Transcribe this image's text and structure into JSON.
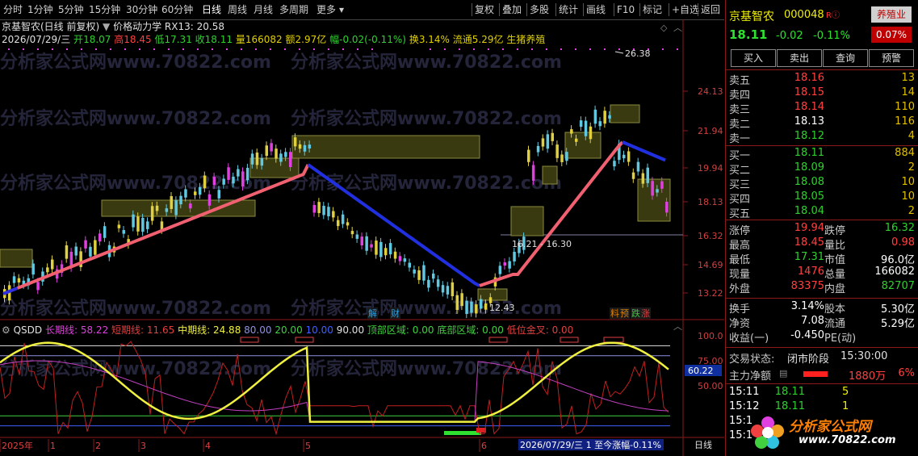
{
  "toolbar": {
    "periods": [
      "分时",
      "1分钟",
      "5分钟",
      "15分钟",
      "30分钟",
      "60分钟",
      "日线",
      "周线",
      "月线",
      "多周期",
      "更多"
    ],
    "active_period": "日线",
    "tools": [
      "复权",
      "叠加",
      "多股",
      "统计",
      "画线",
      "F10",
      "标记",
      "+自选",
      "返回"
    ]
  },
  "chart": {
    "title": "京基智农(日线 前复权)",
    "indicator_name": "价格动力学",
    "indicator_value": "RX13: 20.58",
    "info_date": "2026/07/29/三",
    "info_open_label": "开",
    "info_open": "18.07",
    "info_high_label": "高",
    "info_high": "18.45",
    "info_low_label": "低",
    "info_low": "17.31",
    "info_close_label": "收",
    "info_close": "18.11",
    "info_vol_label": "量",
    "info_vol": "166082",
    "info_amt_label": "额",
    "info_amt": "2.97亿",
    "info_chg_label": "幅",
    "info_chg": "-0.02(-0.11%)",
    "info_turn_label": "换",
    "info_turn": "3.14%",
    "info_float_label": "流通",
    "info_float": "5.29亿",
    "info_sector": "生猪养殖",
    "price_axis": [
      "24.13",
      "21.94",
      "19.94",
      "18.13",
      "16.32",
      "14.69",
      "13.22"
    ],
    "marks": {
      "high": "26.38",
      "low": "12.43",
      "box": "16.21 - 16.30"
    },
    "events": [
      "解",
      "财",
      "料",
      "预",
      "跌",
      "涨"
    ],
    "watermark": "分析家公式网www.70822.com"
  },
  "indicator": {
    "name": "QSDD",
    "long_label": "长期线:",
    "long_value": "58.22",
    "short_label": "短期线:",
    "short_value": "11.65",
    "mid_label": "中期线:",
    "mid_value": "24.88",
    "lvl80": "80.00",
    "lvl20": "20.00",
    "lvl10": "10.00",
    "lvl90": "90.00",
    "top_zone": "顶部区域: 0.00",
    "bottom_zone": "底部区域: 0.00",
    "golden": "低位金叉: 0.00",
    "axis": [
      "100.0",
      "75.00",
      "50.00"
    ],
    "current_tag": "60.22"
  },
  "timeline": {
    "labels": [
      "2025年",
      "1",
      "2",
      "3",
      "4",
      "5",
      "6"
    ],
    "status": "2026/07/29/三  1 至今涨幅-0.11%",
    "period": "日线"
  },
  "panel": {
    "name": "京基智农",
    "code": "000048",
    "badge": "R",
    "sector": "养殖业",
    "price": "18.11",
    "change": "-0.02",
    "pct": "-0.11%",
    "weight": "0.07%",
    "buttons": [
      "买入",
      "卖出",
      "查询",
      "预警"
    ],
    "asks": [
      {
        "label": "卖五",
        "price": "18.16",
        "vol": "13"
      },
      {
        "label": "卖四",
        "price": "18.15",
        "vol": "14"
      },
      {
        "label": "卖三",
        "price": "18.14",
        "vol": "110"
      },
      {
        "label": "卖二",
        "price": "18.13",
        "vol": "116"
      },
      {
        "label": "卖一",
        "price": "18.12",
        "vol": "4"
      }
    ],
    "bids": [
      {
        "label": "买一",
        "price": "18.11",
        "vol": "884"
      },
      {
        "label": "买二",
        "price": "18.09",
        "vol": "2"
      },
      {
        "label": "买三",
        "price": "18.08",
        "vol": "10"
      },
      {
        "label": "买四",
        "price": "18.05",
        "vol": "10"
      },
      {
        "label": "买五",
        "price": "18.04",
        "vol": "2"
      }
    ],
    "stats": [
      {
        "l1": "涨停",
        "v1": "19.94",
        "l2": "跌停",
        "v2": "16.32"
      },
      {
        "l1": "最高",
        "v1": "18.45",
        "l2": "量比",
        "v2": "0.98"
      },
      {
        "l1": "最低",
        "v1": "17.31",
        "l2": "市值",
        "v2": "96.0亿"
      },
      {
        "l1": "现量",
        "v1": "1476",
        "l2": "总量",
        "v2": "166082"
      },
      {
        "l1": "外盘",
        "v1": "83375",
        "l2": "内盘",
        "v2": "82707"
      }
    ],
    "stats2": [
      {
        "l1": "换手",
        "v1": "3.14%",
        "l2": "股本",
        "v2": "5.30亿"
      },
      {
        "l1": "净资",
        "v1": "7.08",
        "l2": "流通",
        "v2": "5.29亿"
      },
      {
        "l1": "收益(一)",
        "v1": "-0.450",
        "l2": "PE(动)",
        "v2": ""
      }
    ],
    "trade_status_label": "交易状态:",
    "trade_status": "闭市阶段",
    "trade_time": "15:30:00",
    "main_flow_label": "主力净额",
    "main_flow": "1880万",
    "main_flow_pct": "6%",
    "ticks": [
      {
        "t": "15:11",
        "p": "18.11",
        "v": "5"
      },
      {
        "t": "15:12",
        "p": "18.11",
        "v": "1"
      },
      {
        "t": "15:1",
        "p": "",
        "v": ""
      },
      {
        "t": "15:1",
        "p": "",
        "v": ""
      }
    ],
    "logo_text": "分析家公式网",
    "logo_url": "www.70822.com"
  }
}
